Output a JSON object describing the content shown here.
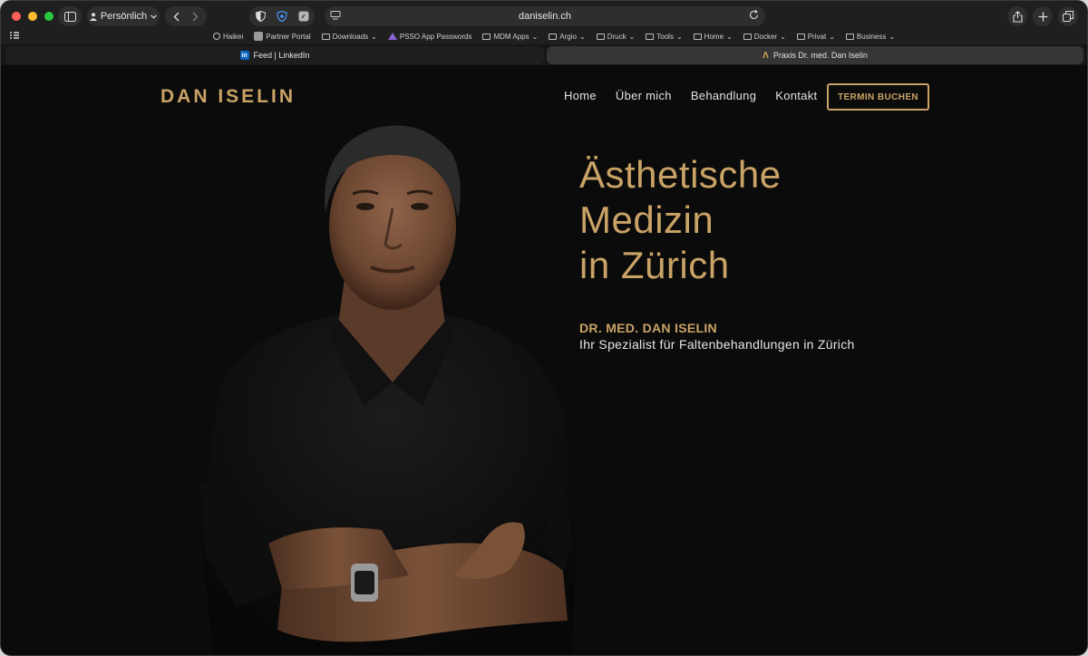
{
  "browser": {
    "profile_label": "Persönlich",
    "address": "daniselin.ch",
    "favorites": [
      {
        "label": "Haikei",
        "icon": "globe-icon"
      },
      {
        "label": "Partner Portal",
        "icon": "site-icon"
      },
      {
        "label": "Downloads",
        "icon": "folder-icon",
        "menu": true
      },
      {
        "label": "PSSO App Passwords",
        "icon": "site-icon"
      },
      {
        "label": "MDM Apps",
        "icon": "folder-icon",
        "menu": true
      },
      {
        "label": "Argio",
        "icon": "folder-icon",
        "menu": true
      },
      {
        "label": "Druck",
        "icon": "folder-icon",
        "menu": true
      },
      {
        "label": "Tools",
        "icon": "folder-icon",
        "menu": true
      },
      {
        "label": "Home",
        "icon": "folder-icon",
        "menu": true
      },
      {
        "label": "Docker",
        "icon": "folder-icon",
        "menu": true
      },
      {
        "label": "Privat",
        "icon": "folder-icon",
        "menu": true
      },
      {
        "label": "Business",
        "icon": "folder-icon",
        "menu": true
      }
    ],
    "tabs": [
      {
        "label": "Feed | LinkedIn",
        "icon": "linkedin-icon",
        "active": false
      },
      {
        "label": "Praxis Dr. med. Dan Iselin",
        "icon": "site-logo-icon",
        "active": true
      }
    ]
  },
  "site": {
    "logo": "DAN ISELIN",
    "nav": [
      "Home",
      "Über mich",
      "Behandlung",
      "Kontakt"
    ],
    "cta": "TERMIN BUCHEN",
    "hero_lines": [
      "Ästhetische",
      "Medizin",
      "in Zürich"
    ],
    "doctor_name": "DR. MED. DAN ISELIN",
    "tagline": "Ihr Spezialist für Faltenbehandlungen in Zürich"
  },
  "colors": {
    "accent_gold": "#c9a366",
    "page_background": "#0b0b0b"
  }
}
